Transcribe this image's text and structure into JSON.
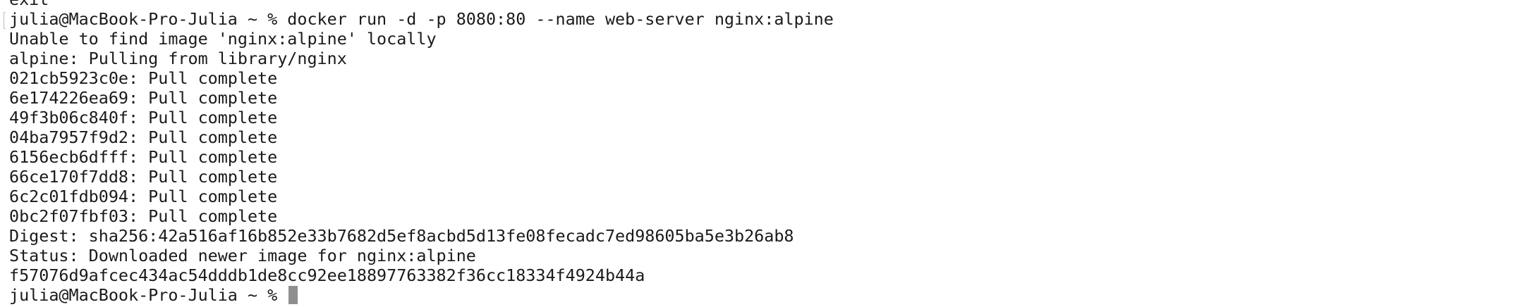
{
  "terminal": {
    "lines": [
      "exit",
      "julia@MacBook-Pro-Julia ~ % docker run -d -p 8080:80 --name web-server nginx:alpine",
      "Unable to find image 'nginx:alpine' locally",
      "alpine: Pulling from library/nginx",
      "021cb5923c0e: Pull complete",
      "6e174226ea69: Pull complete",
      "49f3b06c840f: Pull complete",
      "04ba7957f9d2: Pull complete",
      "6156ecb6dfff: Pull complete",
      "66ce170f7dd8: Pull complete",
      "6c2c01fdb094: Pull complete",
      "0bc2f07fbf03: Pull complete",
      "Digest: sha256:42a516af16b852e33b7682d5ef8acbd5d13fe08fecadc7ed98605ba5e3b26ab8",
      "Status: Downloaded newer image for nginx:alpine",
      "f57076d9afcec434ac54dddb1de8cc92ee18897763382f36cc18334f4924b44a"
    ],
    "prompt": "julia@MacBook-Pro-Julia ~ % ",
    "cursor_color": "#8f8f8f"
  }
}
